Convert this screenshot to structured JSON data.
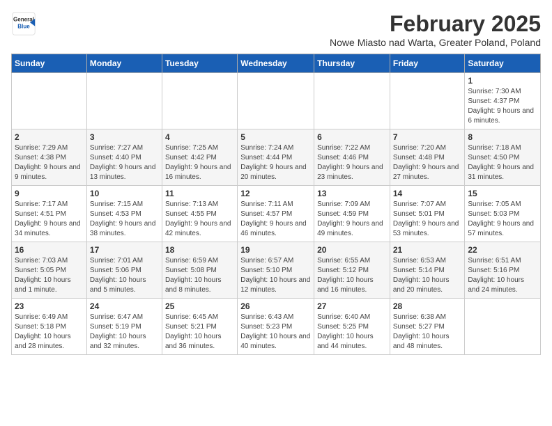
{
  "logo": {
    "line1": "General",
    "line2": "Blue"
  },
  "title": "February 2025",
  "subtitle": "Nowe Miasto nad Warta, Greater Poland, Poland",
  "weekdays": [
    "Sunday",
    "Monday",
    "Tuesday",
    "Wednesday",
    "Thursday",
    "Friday",
    "Saturday"
  ],
  "weeks": [
    [
      {
        "day": "",
        "info": ""
      },
      {
        "day": "",
        "info": ""
      },
      {
        "day": "",
        "info": ""
      },
      {
        "day": "",
        "info": ""
      },
      {
        "day": "",
        "info": ""
      },
      {
        "day": "",
        "info": ""
      },
      {
        "day": "1",
        "info": "Sunrise: 7:30 AM\nSunset: 4:37 PM\nDaylight: 9 hours and 6 minutes."
      }
    ],
    [
      {
        "day": "2",
        "info": "Sunrise: 7:29 AM\nSunset: 4:38 PM\nDaylight: 9 hours and 9 minutes."
      },
      {
        "day": "3",
        "info": "Sunrise: 7:27 AM\nSunset: 4:40 PM\nDaylight: 9 hours and 13 minutes."
      },
      {
        "day": "4",
        "info": "Sunrise: 7:25 AM\nSunset: 4:42 PM\nDaylight: 9 hours and 16 minutes."
      },
      {
        "day": "5",
        "info": "Sunrise: 7:24 AM\nSunset: 4:44 PM\nDaylight: 9 hours and 20 minutes."
      },
      {
        "day": "6",
        "info": "Sunrise: 7:22 AM\nSunset: 4:46 PM\nDaylight: 9 hours and 23 minutes."
      },
      {
        "day": "7",
        "info": "Sunrise: 7:20 AM\nSunset: 4:48 PM\nDaylight: 9 hours and 27 minutes."
      },
      {
        "day": "8",
        "info": "Sunrise: 7:18 AM\nSunset: 4:50 PM\nDaylight: 9 hours and 31 minutes."
      }
    ],
    [
      {
        "day": "9",
        "info": "Sunrise: 7:17 AM\nSunset: 4:51 PM\nDaylight: 9 hours and 34 minutes."
      },
      {
        "day": "10",
        "info": "Sunrise: 7:15 AM\nSunset: 4:53 PM\nDaylight: 9 hours and 38 minutes."
      },
      {
        "day": "11",
        "info": "Sunrise: 7:13 AM\nSunset: 4:55 PM\nDaylight: 9 hours and 42 minutes."
      },
      {
        "day": "12",
        "info": "Sunrise: 7:11 AM\nSunset: 4:57 PM\nDaylight: 9 hours and 46 minutes."
      },
      {
        "day": "13",
        "info": "Sunrise: 7:09 AM\nSunset: 4:59 PM\nDaylight: 9 hours and 49 minutes."
      },
      {
        "day": "14",
        "info": "Sunrise: 7:07 AM\nSunset: 5:01 PM\nDaylight: 9 hours and 53 minutes."
      },
      {
        "day": "15",
        "info": "Sunrise: 7:05 AM\nSunset: 5:03 PM\nDaylight: 9 hours and 57 minutes."
      }
    ],
    [
      {
        "day": "16",
        "info": "Sunrise: 7:03 AM\nSunset: 5:05 PM\nDaylight: 10 hours and 1 minute."
      },
      {
        "day": "17",
        "info": "Sunrise: 7:01 AM\nSunset: 5:06 PM\nDaylight: 10 hours and 5 minutes."
      },
      {
        "day": "18",
        "info": "Sunrise: 6:59 AM\nSunset: 5:08 PM\nDaylight: 10 hours and 8 minutes."
      },
      {
        "day": "19",
        "info": "Sunrise: 6:57 AM\nSunset: 5:10 PM\nDaylight: 10 hours and 12 minutes."
      },
      {
        "day": "20",
        "info": "Sunrise: 6:55 AM\nSunset: 5:12 PM\nDaylight: 10 hours and 16 minutes."
      },
      {
        "day": "21",
        "info": "Sunrise: 6:53 AM\nSunset: 5:14 PM\nDaylight: 10 hours and 20 minutes."
      },
      {
        "day": "22",
        "info": "Sunrise: 6:51 AM\nSunset: 5:16 PM\nDaylight: 10 hours and 24 minutes."
      }
    ],
    [
      {
        "day": "23",
        "info": "Sunrise: 6:49 AM\nSunset: 5:18 PM\nDaylight: 10 hours and 28 minutes."
      },
      {
        "day": "24",
        "info": "Sunrise: 6:47 AM\nSunset: 5:19 PM\nDaylight: 10 hours and 32 minutes."
      },
      {
        "day": "25",
        "info": "Sunrise: 6:45 AM\nSunset: 5:21 PM\nDaylight: 10 hours and 36 minutes."
      },
      {
        "day": "26",
        "info": "Sunrise: 6:43 AM\nSunset: 5:23 PM\nDaylight: 10 hours and 40 minutes."
      },
      {
        "day": "27",
        "info": "Sunrise: 6:40 AM\nSunset: 5:25 PM\nDaylight: 10 hours and 44 minutes."
      },
      {
        "day": "28",
        "info": "Sunrise: 6:38 AM\nSunset: 5:27 PM\nDaylight: 10 hours and 48 minutes."
      },
      {
        "day": "",
        "info": ""
      }
    ]
  ]
}
